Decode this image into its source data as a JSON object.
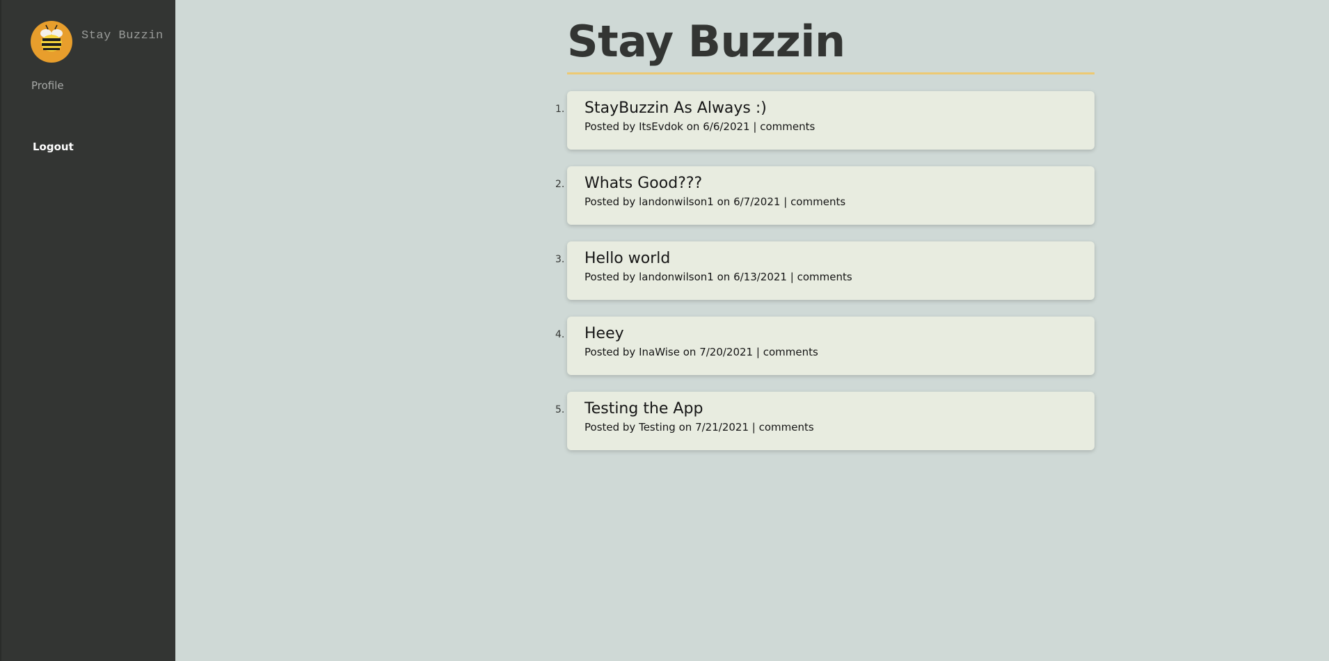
{
  "sidebar": {
    "brand_name": "Stay Buzzin",
    "logo_icon": "bee-icon",
    "profile_label": "Profile",
    "logout_label": "Logout"
  },
  "main": {
    "title": "Stay Buzzin",
    "posts": [
      {
        "num": "1.",
        "title": "StayBuzzin As Always :)",
        "prefix": "Posted by",
        "author": "ItsEvdok",
        "on": "on",
        "date": "6/6/2021",
        "sep": "|",
        "comments": "comments"
      },
      {
        "num": "2.",
        "title": "Whats Good???",
        "prefix": "Posted by",
        "author": "landonwilson1",
        "on": "on",
        "date": "6/7/2021",
        "sep": "|",
        "comments": "comments"
      },
      {
        "num": "3.",
        "title": "Hello world",
        "prefix": "Posted by",
        "author": "landonwilson1",
        "on": "on",
        "date": "6/13/2021",
        "sep": "|",
        "comments": "comments"
      },
      {
        "num": "4.",
        "title": "Heey",
        "prefix": "Posted by",
        "author": "InaWise",
        "on": "on",
        "date": "7/20/2021",
        "sep": "|",
        "comments": "comments"
      },
      {
        "num": "5.",
        "title": "Testing the App",
        "prefix": "Posted by",
        "author": "Testing",
        "on": "on",
        "date": "7/21/2021",
        "sep": "|",
        "comments": "comments"
      }
    ]
  },
  "colors": {
    "sidebar_bg": "#333533",
    "page_bg": "#cfd9d6",
    "accent": "#f2c661",
    "logo_bg": "#e89e2c",
    "card_bg": "#e8ece0"
  }
}
